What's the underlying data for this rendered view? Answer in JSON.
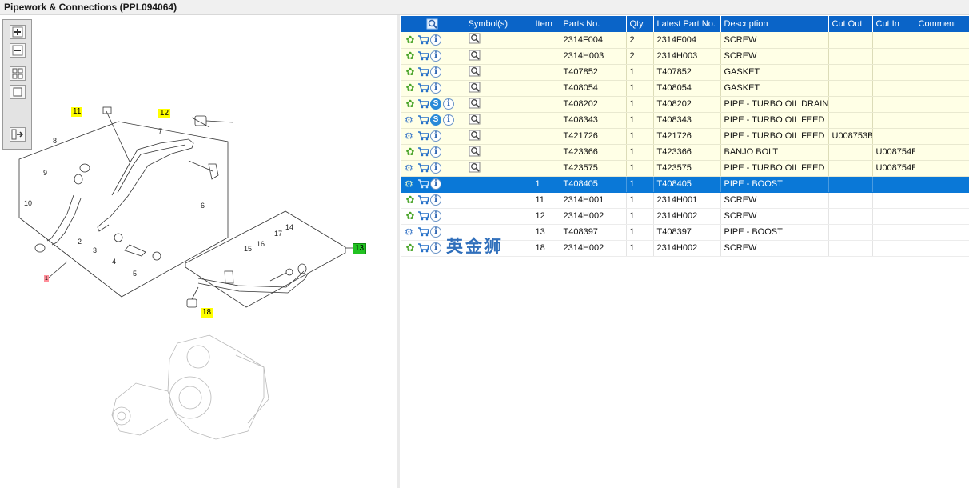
{
  "window": {
    "title": "Pipework & Connections (PPL094064)"
  },
  "diagram": {
    "callouts": [
      {
        "label": "11",
        "color": "yellow"
      },
      {
        "label": "12",
        "color": "yellow"
      },
      {
        "label": "13",
        "color": "green"
      },
      {
        "label": "18",
        "color": "yellow"
      },
      {
        "label": "1",
        "color": "pink"
      }
    ],
    "part_numbers": [
      "7",
      "8",
      "9",
      "10",
      "2",
      "3",
      "4",
      "5",
      "6",
      "15",
      "16",
      "17",
      "14"
    ]
  },
  "zoom_controls": {
    "buttons": [
      "zoom-in",
      "zoom-out",
      "fit-all",
      "actual-size",
      "toggle-layout"
    ]
  },
  "table": {
    "columns": [
      "",
      "Symbol(s)",
      "Item",
      "Parts No.",
      "Qty.",
      "Latest Part No.",
      "Description",
      "Cut Out",
      "Cut In",
      "Comment"
    ],
    "rows": [
      {
        "state": "yellow",
        "gear": "green",
        "s": false,
        "item": "",
        "parts_no": "2314F004",
        "qty": "2",
        "latest": "2314F004",
        "desc": "SCREW",
        "cut_out": "",
        "cut_in": "",
        "comment": "",
        "symbol": true
      },
      {
        "state": "yellow",
        "gear": "green",
        "s": false,
        "item": "",
        "parts_no": "2314H003",
        "qty": "2",
        "latest": "2314H003",
        "desc": "SCREW",
        "cut_out": "",
        "cut_in": "",
        "comment": "",
        "symbol": true
      },
      {
        "state": "yellow",
        "gear": "green",
        "s": false,
        "item": "",
        "parts_no": "T407852",
        "qty": "1",
        "latest": "T407852",
        "desc": "GASKET",
        "cut_out": "",
        "cut_in": "",
        "comment": "",
        "symbol": true
      },
      {
        "state": "yellow",
        "gear": "green",
        "s": false,
        "item": "",
        "parts_no": "T408054",
        "qty": "1",
        "latest": "T408054",
        "desc": "GASKET",
        "cut_out": "",
        "cut_in": "",
        "comment": "",
        "symbol": true
      },
      {
        "state": "yellow",
        "gear": "green",
        "s": true,
        "item": "",
        "parts_no": "T408202",
        "qty": "1",
        "latest": "T408202",
        "desc": "PIPE - TURBO OIL DRAIN",
        "cut_out": "",
        "cut_in": "",
        "comment": "",
        "symbol": true
      },
      {
        "state": "yellow",
        "gear": "multi",
        "s": true,
        "item": "",
        "parts_no": "T408343",
        "qty": "1",
        "latest": "T408343",
        "desc": "PIPE - TURBO OIL FEED",
        "cut_out": "",
        "cut_in": "",
        "comment": "",
        "symbol": true
      },
      {
        "state": "yellow",
        "gear": "multi",
        "s": false,
        "item": "",
        "parts_no": "T421726",
        "qty": "1",
        "latest": "T421726",
        "desc": "PIPE - TURBO OIL FEED",
        "cut_out": "U008753B",
        "cut_in": "",
        "comment": "",
        "symbol": true
      },
      {
        "state": "yellow",
        "gear": "green",
        "s": false,
        "item": "",
        "parts_no": "T423366",
        "qty": "1",
        "latest": "T423366",
        "desc": "BANJO BOLT",
        "cut_out": "",
        "cut_in": "U008754E",
        "comment": "",
        "symbol": true
      },
      {
        "state": "yellow",
        "gear": "multi",
        "s": false,
        "item": "",
        "parts_no": "T423575",
        "qty": "1",
        "latest": "T423575",
        "desc": "PIPE - TURBO OIL FEED",
        "cut_out": "",
        "cut_in": "U008754E",
        "comment": "",
        "symbol": true
      },
      {
        "state": "sel",
        "gear": "multi",
        "s": false,
        "item": "1",
        "parts_no": "T408405",
        "qty": "1",
        "latest": "T408405",
        "desc": "PIPE - BOOST",
        "cut_out": "",
        "cut_in": "",
        "comment": "",
        "symbol": false
      },
      {
        "state": "white",
        "gear": "green",
        "s": false,
        "item": "11",
        "parts_no": "2314H001",
        "qty": "1",
        "latest": "2314H001",
        "desc": "SCREW",
        "cut_out": "",
        "cut_in": "",
        "comment": "",
        "symbol": false
      },
      {
        "state": "white",
        "gear": "green",
        "s": false,
        "item": "12",
        "parts_no": "2314H002",
        "qty": "1",
        "latest": "2314H002",
        "desc": "SCREW",
        "cut_out": "",
        "cut_in": "",
        "comment": "",
        "symbol": false
      },
      {
        "state": "white",
        "gear": "multi",
        "s": false,
        "item": "13",
        "parts_no": "T408397",
        "qty": "1",
        "latest": "T408397",
        "desc": "PIPE - BOOST",
        "cut_out": "",
        "cut_in": "",
        "comment": "",
        "symbol": false
      },
      {
        "state": "white",
        "gear": "green",
        "s": false,
        "item": "18",
        "parts_no": "2314H002",
        "qty": "1",
        "latest": "2314H002",
        "desc": "SCREW",
        "cut_out": "",
        "cut_in": "",
        "comment": "",
        "symbol": false
      }
    ]
  },
  "watermark": {
    "text": "英金狮"
  },
  "colors": {
    "header": "#0a64c8",
    "selected": "#0a78d7",
    "row_yellow": "#ffffe6",
    "callout_yellow": "#ffff00",
    "callout_green": "#22c222",
    "gear_green": "#4aa52a"
  }
}
